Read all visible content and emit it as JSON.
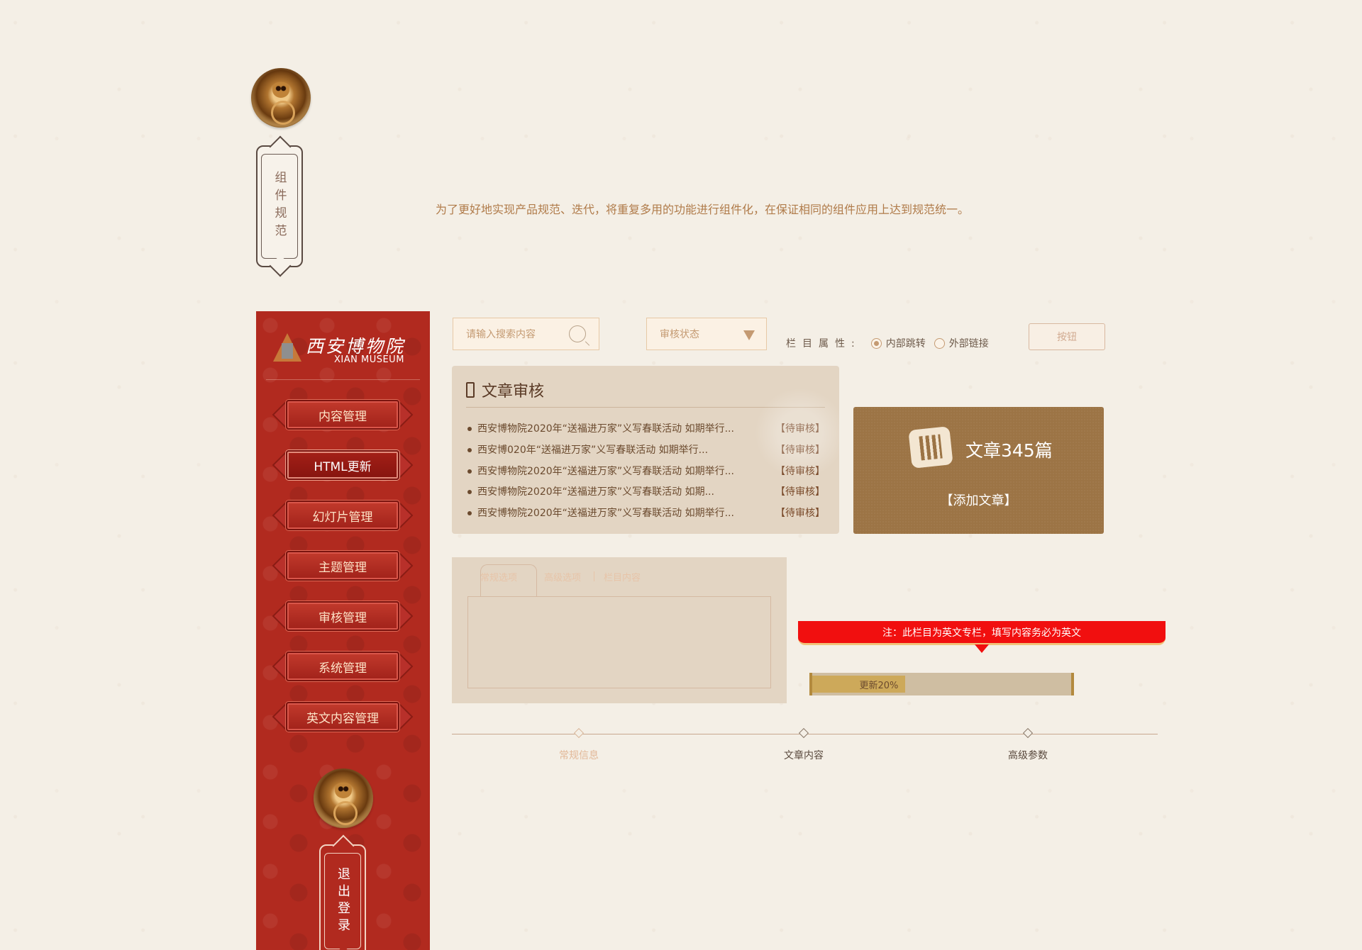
{
  "top": {
    "scroll_title": "组件规范",
    "intro": "为了更好地实现产品规范、迭代，将重复多用的功能进行组件化，在保证相同的组件应用上达到规范统一。"
  },
  "sidebar": {
    "logo_cn": "西安博物院",
    "logo_en": "XIAN MUSEUM",
    "items": [
      {
        "label": "内容管理"
      },
      {
        "label": "HTML更新"
      },
      {
        "label": "幻灯片管理"
      },
      {
        "label": "主题管理"
      },
      {
        "label": "审核管理"
      },
      {
        "label": "系统管理"
      },
      {
        "label": "英文内容管理"
      }
    ],
    "active_index": 1,
    "logout": "退出登录"
  },
  "toolbar": {
    "search_placeholder": "请输入搜索内容",
    "select_value": "审核状态",
    "radio_label": "栏目属性:",
    "radio_options": [
      {
        "label": "内部跳转",
        "checked": true
      },
      {
        "label": "外部链接",
        "checked": false
      }
    ],
    "button_label": "按钮"
  },
  "review": {
    "title": "文章审核",
    "rows": [
      {
        "text": "西安博物院2020年“送福进万家”义写春联活动 如期举行...",
        "status": "【待审核】"
      },
      {
        "text": "西安博020年“送福进万家”义写春联活动 如期举行...",
        "status": "【待审核】"
      },
      {
        "text": "西安博物院2020年“送福进万家”义写春联活动 如期举行...",
        "status": "【待审核】"
      },
      {
        "text": "西安博物院2020年“送福进万家”义写春联活动 如期...",
        "status": "【待审核】"
      },
      {
        "text": "西安博物院2020年“送福进万家”义写春联活动 如期举行...",
        "status": "【待审核】"
      }
    ]
  },
  "stats": {
    "count": "文章345篇",
    "add": "【添加文章】"
  },
  "tabs": {
    "items": [
      "常规选项",
      "高级选项",
      "栏目内容"
    ]
  },
  "alert": {
    "text": "注：此栏目为英文专栏，填写内容务必为英文"
  },
  "progress": {
    "label": "更新20%",
    "value": 0.2
  },
  "steps": [
    "常规信息",
    "文章内容",
    "高级参数"
  ],
  "colors": {
    "background": "#f4efe6",
    "sidebar": "#b12a1f",
    "accent_gold": "#9c7445",
    "alert_red": "#f10f0f"
  }
}
